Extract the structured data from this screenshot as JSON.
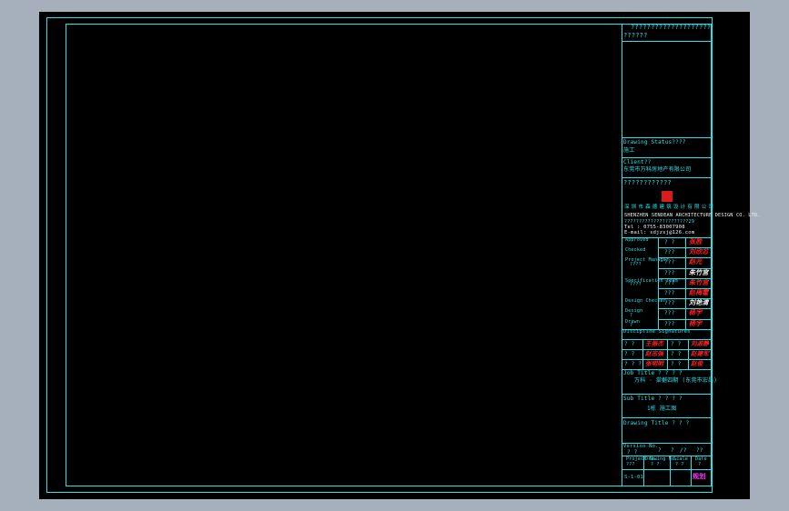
{
  "colors": {
    "background": "#000000",
    "frame": "#25e3ea",
    "stamp_red": "#ff2020",
    "white": "#f2f2f2",
    "magenta": "#ff33ff",
    "window_gray": "#a6b0bd"
  },
  "title_block": {
    "top_line_1": "????????????????????",
    "top_line_2": "??????",
    "drawing_status_label": "Drawing Status????",
    "drawing_status_value": "施工",
    "client_label": "Client??",
    "client_value": "东莞市万科房地产有限公司",
    "design_unit_label": "????????????",
    "company_cn": "深圳市森德建筑设计有限公司",
    "company_en": "SHENZHEN SENDEAN ARCHITECTURE DESIGN CO. LTD.",
    "company_addr": "??????????????????????29",
    "company_tel": "Tel : 0755-83007908",
    "company_email": "E-mail: sdjzsj@126.com",
    "sign_rows": [
      {
        "label": "Approved",
        "q": "? ?",
        "sig": "张胜"
      },
      {
        "label": "Checked",
        "q": "???",
        "sig": "刘欣芯"
      },
      {
        "label": "Project Manager",
        "sub": "????",
        "q": "???",
        "sig": "赵光"
      },
      {
        "label": "",
        "q": "???",
        "sig": "朱竹宫"
      },
      {
        "label": "Specification Team",
        "sub": "????",
        "q": "???",
        "sig": "朱竹宫"
      },
      {
        "label": "",
        "q": "???",
        "sig": "赵梅霍"
      },
      {
        "label": "Design Checker",
        "q": "???",
        "sig": "刘艳清"
      },
      {
        "label": "Design",
        "sub": "?",
        "q": "???",
        "sig": "杨宇"
      },
      {
        "label": "Drawn",
        "sub": "?",
        "q": "???",
        "sig": "杨宇"
      }
    ],
    "discipline_label": "Discipline Signatures",
    "discipline_rows": [
      {
        "a": "? ?",
        "b": "王振杰",
        "c": "? ?",
        "d": "刘淑静"
      },
      {
        "a": "? ?",
        "b": "赵志强",
        "c": "? ?",
        "d": "赵建军"
      },
      {
        "a": "? ? ?",
        "b": "张明明",
        "c": "? ?",
        "d": "赵俊"
      }
    ],
    "job_title_label": "Job Title  ? ? ? ?",
    "job_title_value": "万科 · 棠樾四期 (东莞市宏昌)",
    "sub_title_label": "Sub Title  ? ? ? ?",
    "sub_title_value": "1栋 施工图",
    "drawing_title_label": "Drawing Title ? ? ?",
    "version_label": "Version No.",
    "version_q1": "? ?",
    "version_q2": "?",
    "version_q3": "?",
    "version_q4": "/?",
    "version_q5": "??",
    "footer_labels": [
      "Project No.",
      "Drawing No.",
      "Scale",
      "Date"
    ],
    "footer_values": [
      "???",
      "? ?",
      "? ?",
      "?"
    ],
    "bottom_left": "S-1-01",
    "bottom_right": "规划"
  }
}
